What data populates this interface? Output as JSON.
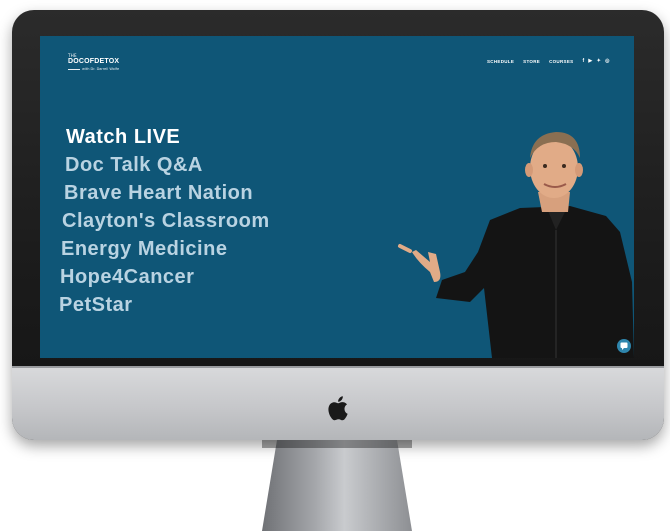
{
  "logo": {
    "the": "THE",
    "main": "DOCOFDETOX",
    "sub": "with Dr. Darrell Wolfe"
  },
  "nav": [
    "SCHEDULE",
    "STORE",
    "COURSES"
  ],
  "social_icons": [
    "facebook-icon",
    "youtube-icon",
    "twitter-icon",
    "instagram-icon"
  ],
  "menu": [
    {
      "label": "Watch LIVE",
      "active": true
    },
    {
      "label": "Doc Talk Q&A",
      "active": false
    },
    {
      "label": "Brave Heart Nation",
      "active": false
    },
    {
      "label": "Clayton's Classroom",
      "active": false
    },
    {
      "label": "Energy Medicine",
      "active": false
    },
    {
      "label": "Hope4Cancer",
      "active": false
    },
    {
      "label": "PetStar",
      "active": false
    }
  ],
  "colors": {
    "screen_bg": "#0f5677",
    "menu_text": "#b9d3e2",
    "active_text": "#ffffff"
  }
}
